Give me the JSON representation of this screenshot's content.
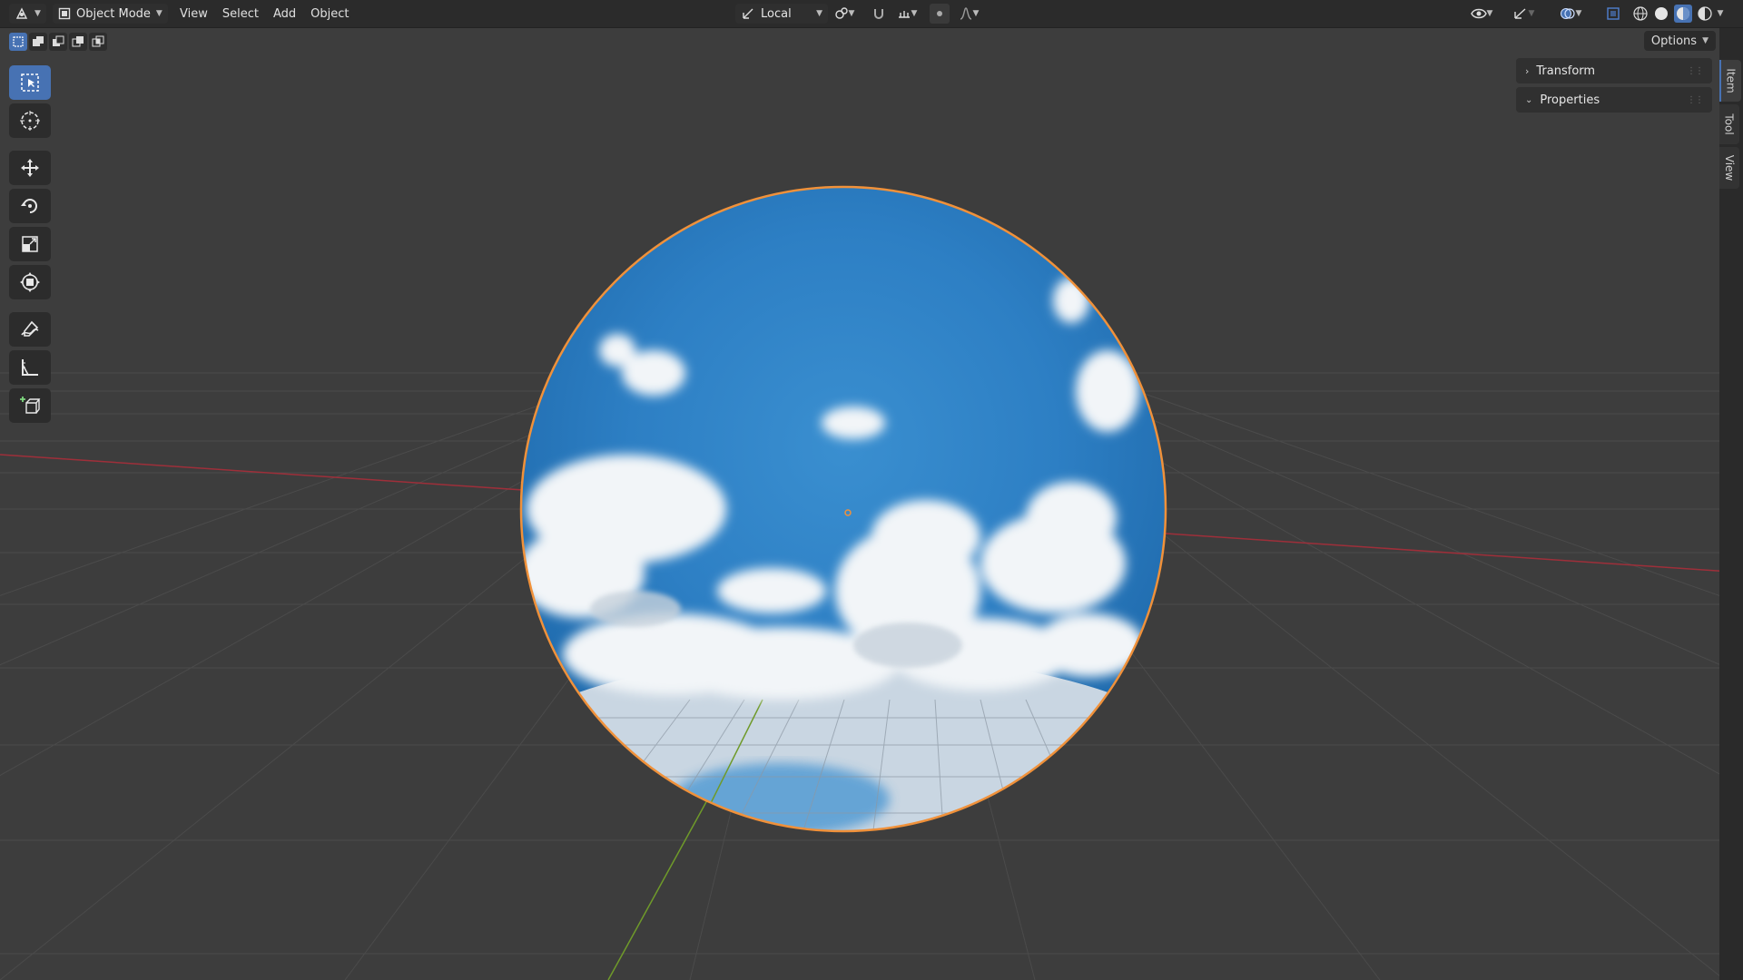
{
  "header": {
    "editor_type_icon": "viewport-editor-icon",
    "mode_label": "Object Mode",
    "menus": [
      "View",
      "Select",
      "Add",
      "Object"
    ],
    "orientation_label": "Local",
    "options_label": "Options"
  },
  "toolbar": {
    "tools": [
      {
        "name": "select-box-tool",
        "icon": "select-box-icon",
        "active": true
      },
      {
        "name": "cursor-tool",
        "icon": "cursor-icon",
        "active": false
      },
      {
        "name": "move-tool",
        "icon": "move-icon",
        "active": false
      },
      {
        "name": "rotate-tool",
        "icon": "rotate-icon",
        "active": false
      },
      {
        "name": "scale-tool",
        "icon": "scale-icon",
        "active": false
      },
      {
        "name": "transform-tool",
        "icon": "transform-icon",
        "active": false
      },
      {
        "name": "annotate-tool",
        "icon": "annotate-icon",
        "active": false
      },
      {
        "name": "measure-tool",
        "icon": "measure-icon",
        "active": false
      },
      {
        "name": "add-cube-tool",
        "icon": "add-cube-icon",
        "active": false
      }
    ]
  },
  "npanel": {
    "transform_label": "Transform",
    "properties_label": "Properties"
  },
  "side_tabs": {
    "item": "Item",
    "tool": "Tool",
    "view": "View"
  },
  "colors": {
    "accent": "#4772b3",
    "selection_outline": "#f0913a",
    "x_axis": "#9e2f3a",
    "y_axis": "#6f9a2a",
    "grid": "#505050",
    "viewport_bg": "#3d3d3d"
  }
}
